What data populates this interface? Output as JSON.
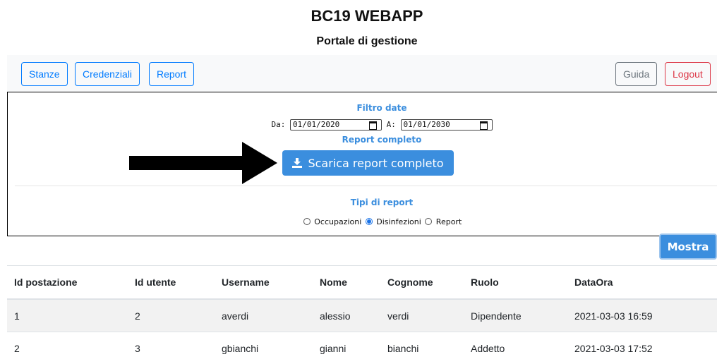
{
  "header": {
    "title": "BC19 WEBAPP",
    "subtitle": "Portale di gestione"
  },
  "nav": {
    "left": [
      "Stanze",
      "Credenziali",
      "Report"
    ],
    "guida": "Guida",
    "logout": "Logout"
  },
  "filter": {
    "title": "Filtro date",
    "from_label": "Da:",
    "from_value": "01/01/2020",
    "to_label": "A:",
    "to_value": "01/01/2030",
    "full_report_title": "Report completo",
    "download_label": "Scarica report completo"
  },
  "report_types": {
    "title": "Tipi di report",
    "options": [
      "Occupazioni",
      "Disinfezioni",
      "Report"
    ],
    "selected": "Disinfezioni"
  },
  "show_button": "Mostra",
  "table": {
    "headers": [
      "Id postazione",
      "Id utente",
      "Username",
      "Nome",
      "Cognome",
      "Ruolo",
      "DataOra"
    ],
    "rows": [
      [
        "1",
        "2",
        "averdi",
        "alessio",
        "verdi",
        "Dipendente",
        "2021-03-03 16:59"
      ],
      [
        "2",
        "3",
        "gbianchi",
        "gianni",
        "bianchi",
        "Addetto",
        "2021-03-03 17:52"
      ]
    ]
  },
  "colors": {
    "primary": "#007bff",
    "accent_blue": "#3b8ede",
    "danger": "#dc3545",
    "secondary": "#6c757d"
  }
}
